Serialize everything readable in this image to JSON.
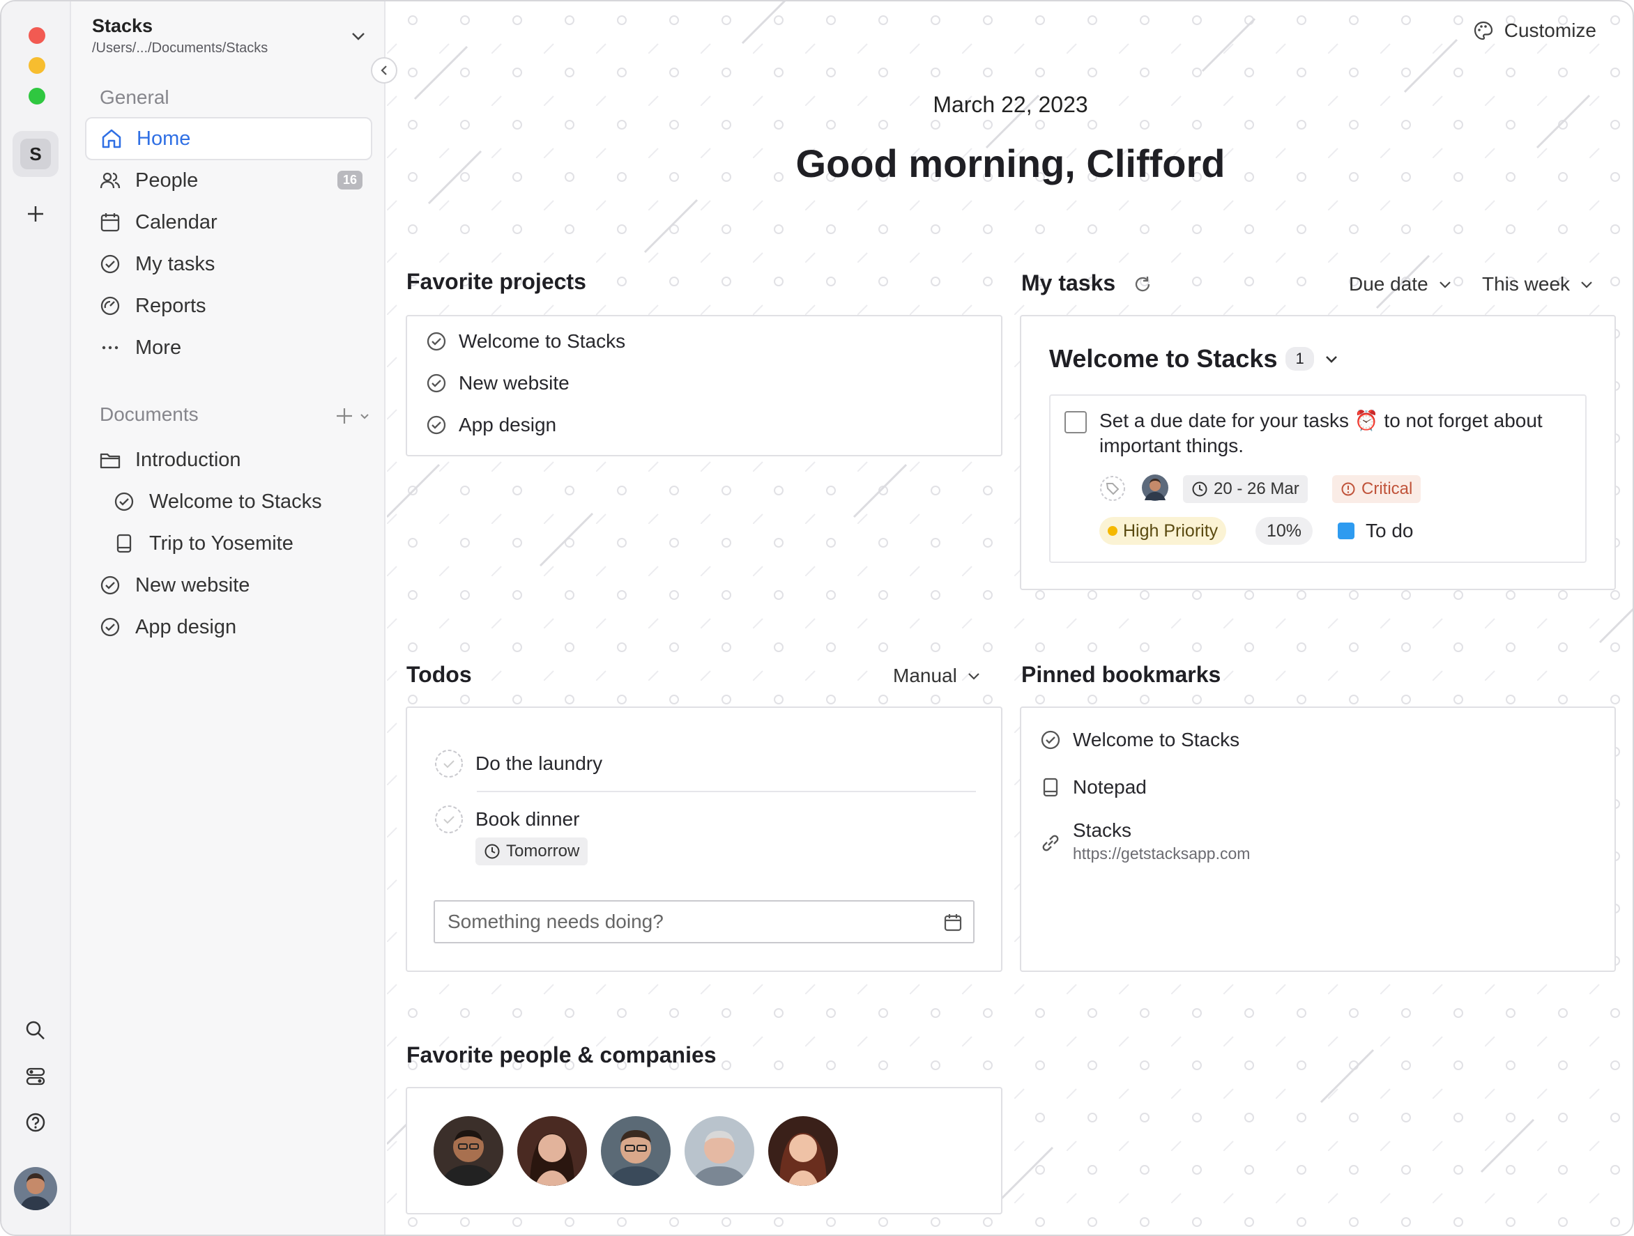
{
  "app": {
    "name": "Stacks",
    "path": "/Users/.../Documents/Stacks",
    "workspace_initial": "S"
  },
  "sidebar": {
    "general_label": "General",
    "nav": [
      {
        "label": "Home",
        "icon": "home-icon",
        "active": true
      },
      {
        "label": "People",
        "icon": "people-icon",
        "badge": "16"
      },
      {
        "label": "Calendar",
        "icon": "calendar-icon"
      },
      {
        "label": "My tasks",
        "icon": "check-circle-icon"
      },
      {
        "label": "Reports",
        "icon": "gauge-icon"
      },
      {
        "label": "More",
        "icon": "more-icon"
      }
    ],
    "documents_label": "Documents",
    "documents": [
      {
        "label": "Introduction",
        "icon": "folder-icon"
      },
      {
        "label": "Welcome to Stacks",
        "icon": "check-circle-icon"
      },
      {
        "label": "Trip to Yosemite",
        "icon": "notebook-icon"
      },
      {
        "label": "New website",
        "icon": "check-circle-icon"
      },
      {
        "label": "App design",
        "icon": "check-circle-icon"
      }
    ]
  },
  "header": {
    "customize": "Customize",
    "date": "March 22, 2023",
    "greeting": "Good morning, Clifford"
  },
  "favorite_projects": {
    "title": "Favorite projects",
    "items": [
      "Welcome to Stacks",
      "New website",
      "App design"
    ]
  },
  "my_tasks": {
    "title": "My tasks",
    "sort": "Due date",
    "range": "This week",
    "group": {
      "name": "Welcome to Stacks",
      "count": "1"
    },
    "task": {
      "text_before": "Set a due date for your tasks",
      "emoji": "⏰",
      "text_after": "to not forget about important things.",
      "dates": "20 - 26 Mar",
      "critical": "Critical",
      "priority": "High Priority",
      "progress": "10%",
      "status": "To do"
    }
  },
  "todos": {
    "title": "Todos",
    "sort": "Manual",
    "items": [
      {
        "label": "Do the laundry"
      },
      {
        "label": "Book dinner",
        "due": "Tomorrow"
      }
    ],
    "placeholder": "Something needs doing?"
  },
  "bookmarks": {
    "title": "Pinned bookmarks",
    "items": [
      {
        "label": "Welcome to Stacks",
        "icon": "check-circle-icon"
      },
      {
        "label": "Notepad",
        "icon": "notebook-icon"
      },
      {
        "label": "Stacks",
        "url": "https://getstacksapp.com",
        "icon": "link-icon"
      }
    ]
  },
  "favorite_people": {
    "title": "Favorite people & companies"
  },
  "colors": {
    "accent": "#2f6fe4",
    "critical": "#c0533a",
    "priority": "#f5b800",
    "status": "#2e9bf0"
  }
}
